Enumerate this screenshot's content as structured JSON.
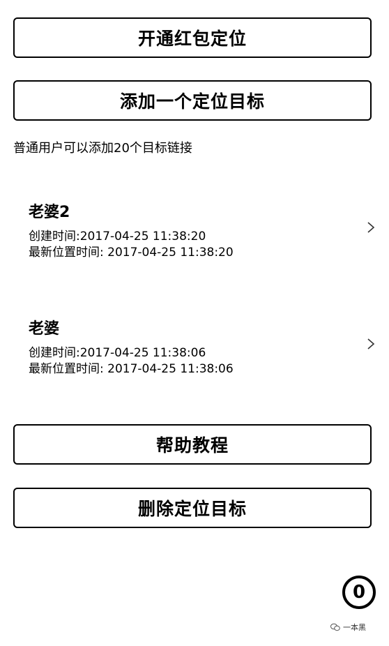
{
  "buttons": {
    "open_red_packet_location": "开通红包定位",
    "add_target": "添加一个定位目标",
    "help_tutorial": "帮助教程",
    "delete_target": "删除定位目标"
  },
  "hint_text": "普通用户可以添加20个目标链接",
  "targets": [
    {
      "name": "老婆2",
      "created": "创建时间:2017-04-25 11:38:20",
      "updated": "最新位置时间: 2017-04-25 11:38:20"
    },
    {
      "name": "老婆",
      "created": "创建时间:2017-04-25 11:38:06",
      "updated": "最新位置时间: 2017-04-25 11:38:06"
    }
  ],
  "badge_count": "0",
  "watermark": {
    "text": "一本黑",
    "icon": "wechat-icon"
  },
  "icons": {
    "row_chevron": "chevron-right-icon"
  },
  "colors": {
    "foreground": "#000000",
    "background": "#ffffff"
  }
}
